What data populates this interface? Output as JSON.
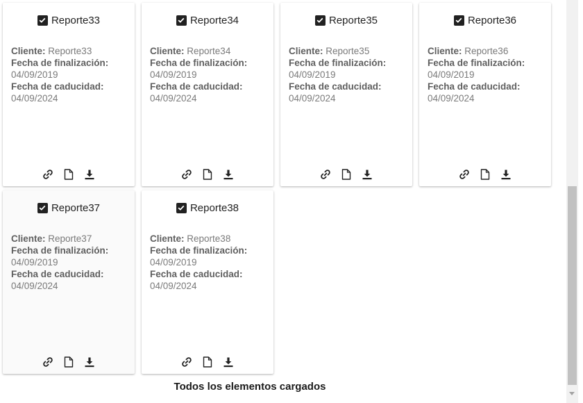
{
  "labels": {
    "cliente": "Cliente:",
    "finalizacion": "Fecha de finalización:",
    "caducidad": "Fecha de caducidad:"
  },
  "cards": [
    {
      "title": "Reporte33",
      "cliente": "Reporte33",
      "finalizacion": "04/09/2019",
      "caducidad": "04/09/2024"
    },
    {
      "title": "Reporte34",
      "cliente": "Reporte34",
      "finalizacion": "04/09/2019",
      "caducidad": "04/09/2024"
    },
    {
      "title": "Reporte35",
      "cliente": "Reporte35",
      "finalizacion": "04/09/2019",
      "caducidad": "04/09/2024"
    },
    {
      "title": "Reporte36",
      "cliente": "Reporte36",
      "finalizacion": "04/09/2019",
      "caducidad": "04/09/2024"
    },
    {
      "title": "Reporte37",
      "cliente": "Reporte37",
      "finalizacion": "04/09/2019",
      "caducidad": "04/09/2024"
    },
    {
      "title": "Reporte38",
      "cliente": "Reporte38",
      "finalizacion": "04/09/2019",
      "caducidad": "04/09/2024"
    }
  ],
  "icons": {
    "link": "link-icon",
    "document": "document-icon",
    "download": "download-icon",
    "checkbox": "checkbox-checked-icon"
  },
  "footer": {
    "text": "Todos los elementos cargados"
  }
}
